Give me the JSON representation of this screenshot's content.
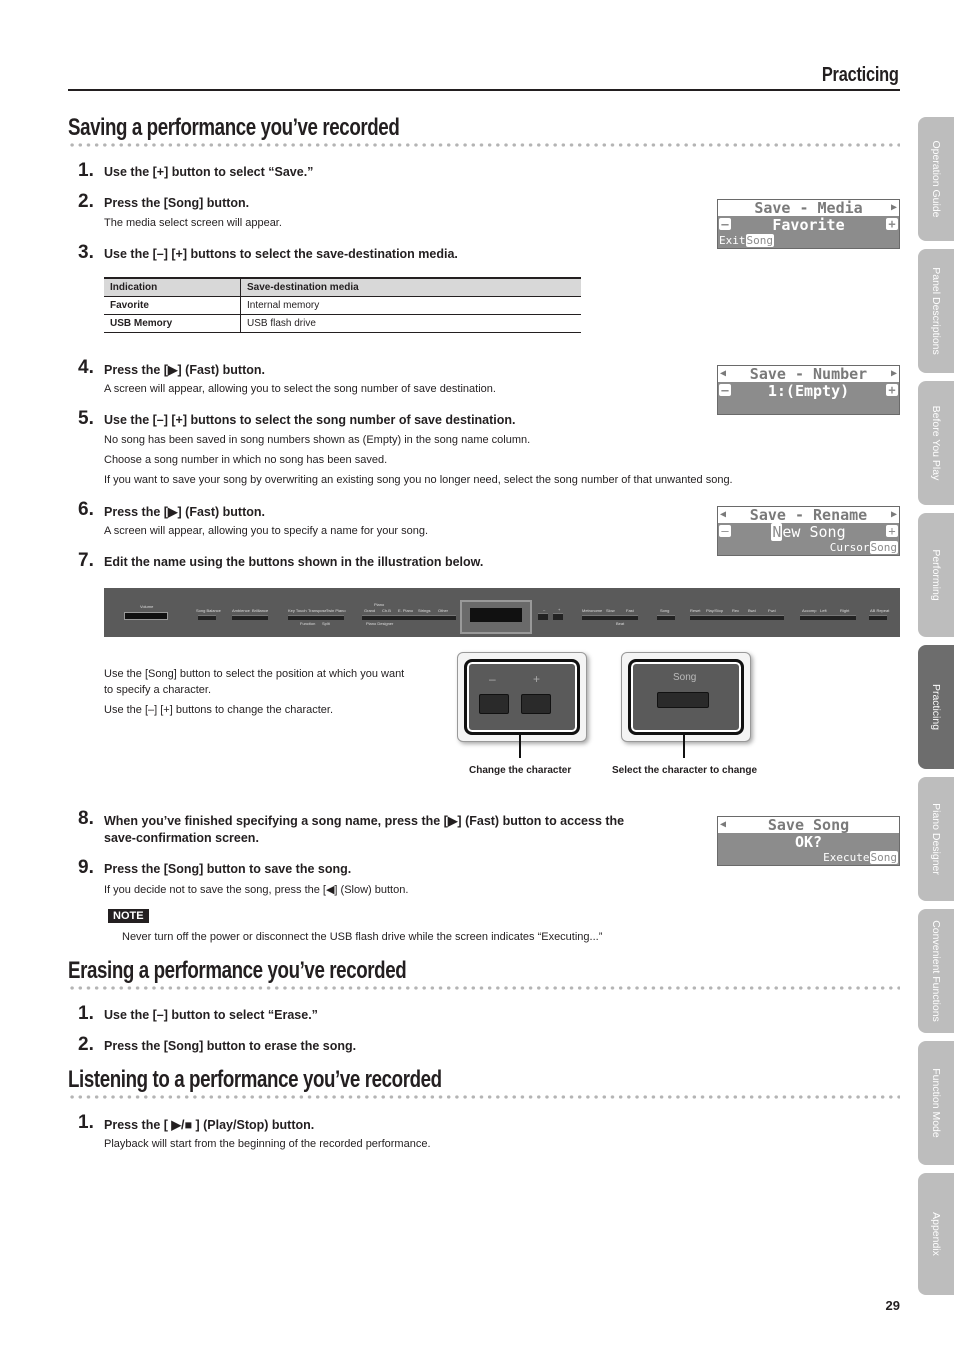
{
  "header": {
    "chapter": "Practicing"
  },
  "sections": {
    "saving": {
      "title": "Saving a performance you’ve recorded",
      "steps": [
        {
          "num": "1.",
          "title": "Use the [+] button to select “Save.”"
        },
        {
          "num": "2.",
          "title": "Press the [Song] button.",
          "body": [
            "The media select screen will appear."
          ]
        },
        {
          "num": "3.",
          "title": "Use the [–] [+] buttons to select the save-destination media."
        },
        {
          "num": "4.",
          "title": "Press the [▶] (Fast) button.",
          "body": [
            "A screen will appear, allowing you to select the song number of save destination."
          ]
        },
        {
          "num": "5.",
          "title": "Use the [–] [+] buttons to select the song number of save destination.",
          "body": [
            "No song has been saved in song numbers shown as (Empty) in the song name column.",
            "Choose a song number in which no song has been saved.",
            "If you want to save your song by overwriting an existing song you no longer need, select the song number of that unwanted song."
          ]
        },
        {
          "num": "6.",
          "title": "Press the [▶] (Fast) button.",
          "body": [
            "A screen will appear, allowing you to specify a name for your song."
          ]
        },
        {
          "num": "7.",
          "title": "Edit the name using the buttons shown in the illustration below."
        },
        {
          "num": "8.",
          "title": "When you’ve finished specifying a song name, press the [▶] (Fast) button to access the",
          "title2": "save-confirmation screen."
        },
        {
          "num": "9.",
          "title": "Press the [Song] button to save the song.",
          "body": [
            "If you decide not to save the song, press the [◀] (Slow) button."
          ]
        }
      ],
      "media_table": {
        "headers": [
          "Indication",
          "Save-destination media"
        ],
        "rows": [
          [
            "Favorite",
            "Internal memory"
          ],
          [
            "USB Memory",
            "USB flash drive"
          ]
        ]
      },
      "illustration": {
        "instructions": [
          "Use the [Song] button to select the position at which you want",
          "to specify a character.",
          "Use the [–] [+] buttons to change the character."
        ],
        "callout_left": {
          "minus": "–",
          "plus": "+",
          "caption": "Change the character"
        },
        "callout_right": {
          "label": "Song",
          "caption": "Select the character to change"
        },
        "panel_labels": [
          "Volume",
          "Song Balance",
          "Ambience",
          "Brilliance",
          "Key Touch",
          "Transpose",
          "Twin Piano",
          "Function",
          "Split",
          "Piano",
          "Grand",
          "Ch.B",
          "E. Piano",
          "Strings",
          "Other",
          "Piano Designer",
          "–",
          "+",
          "Metronome",
          "Slow",
          "Fast",
          "Beat",
          "Song",
          "Reset",
          "Play/Stop",
          "Rec",
          "Bwd",
          "Fwd",
          "Accomp",
          "Left",
          "Right",
          "AB Repeat"
        ]
      },
      "note": {
        "badge": "NOTE",
        "text": "Never turn off the power or disconnect the USB flash drive while the screen indicates “Executing...”"
      }
    },
    "erasing": {
      "title": "Erasing a performance you’ve recorded",
      "steps": [
        {
          "num": "1.",
          "title": "Use the [–] button to select “Erase.”"
        },
        {
          "num": "2.",
          "title": "Press the [Song] button to erase the song."
        }
      ]
    },
    "listening": {
      "title": "Listening to a performance you’ve recorded",
      "steps": [
        {
          "num": "1.",
          "title": "Press the [ ▶/■ ] (Play/Stop) button.",
          "body": [
            "Playback will start from the beginning of the recorded performance."
          ]
        }
      ]
    }
  },
  "lcd_screens": [
    {
      "name": "save-media",
      "row1": "Save - Media",
      "row2": "Favorite",
      "row3_left": "Exit",
      "row3_inv": "Song",
      "left_arrow": false,
      "right_arrow": true,
      "minus": true,
      "plus": true
    },
    {
      "name": "save-number",
      "row1": "Save - Number",
      "row2": "1:(Empty)",
      "left_arrow": true,
      "right_arrow": true,
      "minus": true,
      "plus": true
    },
    {
      "name": "save-rename",
      "row1": "Save - Rename",
      "row2_cursor": "N",
      "row2": "ew Song",
      "row3_right": "Cursor",
      "row3_inv": "Song",
      "left_arrow": true,
      "right_arrow": true,
      "minus": true,
      "plus": true
    },
    {
      "name": "save-song",
      "row1": "Save Song",
      "row2": "OK?",
      "row3_right": "Execute",
      "row3_inv": "Song",
      "left_arrow": true,
      "right_arrow": false
    }
  ],
  "side_tabs": [
    {
      "label": "Operation Guide",
      "active": false
    },
    {
      "label": "Panel Descriptions",
      "active": false
    },
    {
      "label": "Before You Play",
      "active": false
    },
    {
      "label": "Performing",
      "active": false
    },
    {
      "label": "Practicing",
      "active": true
    },
    {
      "label": "Piano Designer",
      "active": false
    },
    {
      "label": "Convenient Functions",
      "active": false
    },
    {
      "label": "Function Mode",
      "active": false
    },
    {
      "label": "Appendix",
      "active": false
    }
  ],
  "page_number": "29",
  "glyphs": {
    "left_arrow": "◀",
    "right_arrow": "▶",
    "minus_box": "–",
    "plus_box": "+"
  }
}
